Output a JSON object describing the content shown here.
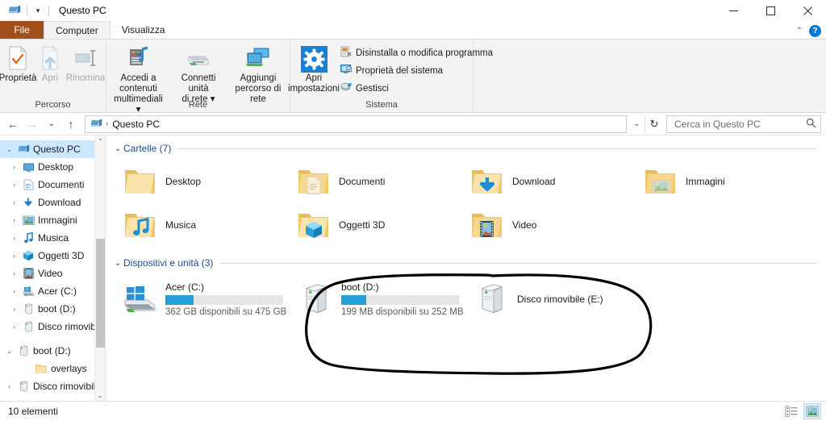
{
  "window": {
    "title": "Questo PC",
    "icon": "this-pc-icon",
    "quick_access_caret": "▾",
    "controls": {
      "minimize": "—",
      "maximize": "□",
      "close": "✕"
    }
  },
  "ribbon": {
    "tabs": [
      {
        "id": "file",
        "label": "File",
        "state": "file"
      },
      {
        "id": "computer",
        "label": "Computer",
        "state": "active"
      },
      {
        "id": "visualizza",
        "label": "Visualizza",
        "state": "plain"
      }
    ],
    "collapse_icon": "chevron-up-icon",
    "help_icon": "?",
    "groups": [
      {
        "id": "percorso",
        "label": "Percorso",
        "buttons": [
          {
            "id": "proprieta",
            "label": "Proprietà",
            "icon": "properties-icon",
            "enabled": true
          },
          {
            "id": "apri",
            "label": "Apri",
            "icon": "open-icon",
            "enabled": false
          },
          {
            "id": "rinomina",
            "label": "Rinomina",
            "icon": "rename-icon",
            "enabled": false
          }
        ]
      },
      {
        "id": "rete",
        "label": "Rete",
        "buttons": [
          {
            "id": "accedi-contenuti-multimediali",
            "label": "Accedi a contenuti\nmultimediali ▾",
            "icon": "media-server-icon",
            "enabled": true
          },
          {
            "id": "connetti-unita-rete",
            "label": "Connetti unità\ndi rete ▾",
            "icon": "map-network-drive-icon",
            "enabled": true
          },
          {
            "id": "aggiungi-percorso-rete",
            "label": "Aggiungi\npercorso di rete",
            "icon": "add-network-location-icon",
            "enabled": true
          }
        ]
      },
      {
        "id": "sistema",
        "label": "Sistema",
        "big_button": {
          "id": "apri-impostazioni",
          "label": "Apri\nimpostazioni",
          "icon": "settings-gear-icon"
        },
        "small_buttons": [
          {
            "id": "disinstalla-modifica-programma",
            "label": "Disinstalla o modifica programma",
            "icon": "uninstall-icon"
          },
          {
            "id": "proprieta-del-sistema",
            "label": "Proprietà del sistema",
            "icon": "system-properties-icon"
          },
          {
            "id": "gestisci",
            "label": "Gestisci",
            "icon": "manage-icon"
          }
        ]
      }
    ]
  },
  "addressbar": {
    "back": "←",
    "forward": "→",
    "recent": "⌄",
    "up": "↑",
    "breadcrumb_icon": "this-pc-icon",
    "breadcrumb_separator": "›",
    "breadcrumb": "Questo PC",
    "dropdown_caret": "⌄",
    "refresh": "↻",
    "search_placeholder": "Cerca in Questo PC",
    "search_value": "",
    "search_icon": "search-icon"
  },
  "sidebar": {
    "items": [
      {
        "id": "questo-pc",
        "label": "Questo PC",
        "icon": "this-pc-icon",
        "level": 0,
        "expander": "⌄",
        "selected": true
      },
      {
        "id": "desktop",
        "label": "Desktop",
        "icon": "desktop-icon",
        "level": 1,
        "expander": "›",
        "selected": false
      },
      {
        "id": "documenti",
        "label": "Documenti",
        "icon": "documents-icon",
        "level": 1,
        "expander": "›",
        "selected": false
      },
      {
        "id": "download",
        "label": "Download",
        "icon": "downloads-icon",
        "level": 1,
        "expander": "›",
        "selected": false
      },
      {
        "id": "immagini",
        "label": "Immagini",
        "icon": "pictures-icon",
        "level": 1,
        "expander": "›",
        "selected": false
      },
      {
        "id": "musica",
        "label": "Musica",
        "icon": "music-icon",
        "level": 1,
        "expander": "›",
        "selected": false
      },
      {
        "id": "oggetti-3d",
        "label": "Oggetti 3D",
        "icon": "3d-objects-icon",
        "level": 1,
        "expander": "›",
        "selected": false
      },
      {
        "id": "video",
        "label": "Video",
        "icon": "videos-icon",
        "level": 1,
        "expander": "›",
        "selected": false
      },
      {
        "id": "acer-c",
        "label": "Acer (C:)",
        "icon": "windows-drive-icon",
        "level": 1,
        "expander": "›",
        "selected": false
      },
      {
        "id": "boot-d-child",
        "label": "boot (D:)",
        "icon": "removable-drive-icon",
        "level": 1,
        "expander": "›",
        "selected": false
      },
      {
        "id": "disco-rimovibile-child",
        "label": "Disco rimovibile",
        "icon": "removable-drive-icon",
        "level": 1,
        "expander": "›",
        "selected": false
      },
      {
        "id": "boot-d-root",
        "label": "boot (D:)",
        "icon": "removable-drive-icon",
        "level": 0,
        "expander": "⌄",
        "selected": false,
        "gap_before": true
      },
      {
        "id": "overlays",
        "label": "overlays",
        "icon": "folder-icon",
        "level": 2,
        "expander": "",
        "selected": false
      },
      {
        "id": "disco-rimovibile-root",
        "label": "Disco rimovibile (",
        "icon": "removable-drive-icon",
        "level": 0,
        "expander": "›",
        "selected": false
      }
    ],
    "scroll": {
      "up_arrow": "⌃",
      "down_arrow": "⌄"
    }
  },
  "content": {
    "groups": [
      {
        "id": "cartelle",
        "caret": "⌄",
        "header": "Cartelle (7)",
        "items": [
          {
            "id": "desktop",
            "label": "Desktop",
            "icon": "folder-desktop-icon"
          },
          {
            "id": "documenti",
            "label": "Documenti",
            "icon": "folder-documents-icon"
          },
          {
            "id": "download",
            "label": "Download",
            "icon": "folder-downloads-icon"
          },
          {
            "id": "immagini",
            "label": "Immagini",
            "icon": "folder-pictures-icon"
          },
          {
            "id": "musica",
            "label": "Musica",
            "icon": "folder-music-icon"
          },
          {
            "id": "oggetti-3d",
            "label": "Oggetti 3D",
            "icon": "folder-3dobjects-icon"
          },
          {
            "id": "video",
            "label": "Video",
            "icon": "folder-videos-icon"
          }
        ]
      },
      {
        "id": "dispositivi-unita",
        "caret": "⌄",
        "header": "Dispositivi e unità (3)",
        "drives": [
          {
            "id": "acer-c",
            "name": "Acer (C:)",
            "icon": "windows-drive-icon",
            "free_text": "362 GB disponibili su 475 GB",
            "used_percent": 24,
            "bar_color": "#26a0da",
            "has_bar": true
          },
          {
            "id": "boot-d",
            "name": "boot (D:)",
            "icon": "removable-drive-icon",
            "free_text": "199 MB disponibili su 252 MB",
            "used_percent": 21,
            "bar_color": "#26a0da",
            "has_bar": true
          },
          {
            "id": "disco-rimovibile-e",
            "name": "Disco rimovibile (E:)",
            "icon": "removable-drive-icon",
            "free_text": "",
            "used_percent": 0,
            "bar_color": "#26a0da",
            "has_bar": false
          }
        ]
      }
    ]
  },
  "statusbar": {
    "item_count": "10 elementi",
    "views": [
      {
        "id": "details-view",
        "icon": "details-view-icon",
        "active": false
      },
      {
        "id": "large-icons-view",
        "icon": "large-icons-view-icon",
        "active": true
      }
    ]
  },
  "annotation": {
    "type": "hand-drawn-ellipse",
    "color": "#000000",
    "encircles": "boot (D:) and Disco rimovibile (E:) drives"
  }
}
